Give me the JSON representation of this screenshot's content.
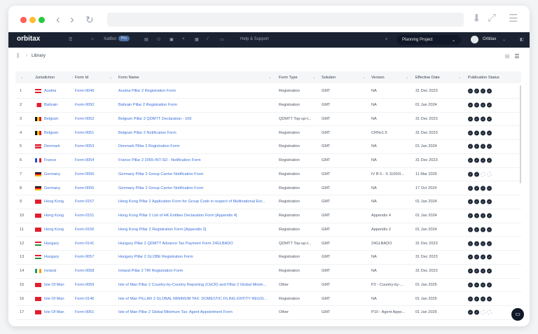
{
  "browser": {
    "back": "‹",
    "forward": "›",
    "reload": "↻",
    "download": "⬇",
    "expand": "⤢",
    "menu": "☰"
  },
  "app": {
    "logo": "orbitax",
    "xatbot": "XatBot",
    "xatbot_badge": "Pro",
    "help": "Help & Support",
    "project": "Planning Project",
    "user": "Orbitax"
  },
  "breadcrumb": {
    "current": "Library"
  },
  "columns": [
    "Jurisdiction",
    "Form Id",
    "Form Name",
    "Form Type",
    "Solution",
    "Version",
    "Effective Date",
    "Publication Status"
  ],
  "rows": [
    {
      "n": "1",
      "j": "Austria",
      "flag": "austria",
      "id": "Form-0049",
      "name": "Austria Pillar 2 Registration Form",
      "type": "Registration",
      "sol": "GMT",
      "ver": "NA",
      "date": "31 Dec 2023",
      "pub": 4
    },
    {
      "n": "2",
      "j": "Bahrain",
      "flag": "bahrain",
      "id": "Form-0050",
      "name": "Bahrain Pillar 2 Registration Form",
      "type": "Registration",
      "sol": "GMT",
      "ver": "NA",
      "date": "01 Jan 2024",
      "pub": 4
    },
    {
      "n": "3",
      "j": "Belgium",
      "flag": "belgium",
      "id": "Form-0052",
      "name": "Belgium Pillar 2 QDMTT Declaration - 169",
      "type": "QDMTT Top-up-t...",
      "sol": "GMT",
      "ver": "NA",
      "date": "31 Dec 2023",
      "pub": 4
    },
    {
      "n": "4",
      "j": "Belgium",
      "flag": "belgium",
      "id": "Form-0051",
      "name": "Belgium Pillar 2 Notification Form",
      "type": "Registration",
      "sol": "GMT",
      "ver": "CRNv1.5",
      "date": "31 Dec 2023",
      "pub": 4
    },
    {
      "n": "5",
      "j": "Denmark",
      "flag": "denmark",
      "id": "Form-0053",
      "name": "Denmark Pillar 2 Registration Form",
      "type": "Registration",
      "sol": "GMT",
      "ver": "NA",
      "date": "01 Jan 2024",
      "pub": 4
    },
    {
      "n": "6",
      "j": "France",
      "flag": "france",
      "id": "Form-0054",
      "name": "France Pillar 2 2065-INT-SD - Notification Form",
      "type": "Registration",
      "sol": "GMT",
      "ver": "NA",
      "date": "31 Dec 2023",
      "pub": 4
    },
    {
      "n": "7",
      "j": "Germany",
      "flag": "germany",
      "id": "Form-0056",
      "name": "Germany Pillar 2 Group Carrier Notification Form",
      "type": "Registration",
      "sol": "GMT",
      "ver": "IV B 5 - S 1100/0...",
      "date": "11 Mar 2025",
      "pub": 2
    },
    {
      "n": "8",
      "j": "Germany",
      "flag": "germany",
      "id": "Form-0055",
      "name": "Germany Pillar 2 Group Carrier Notification Form",
      "type": "Registration",
      "sol": "GMT",
      "ver": "NA",
      "date": "17 Oct 2024",
      "pub": 4
    },
    {
      "n": "9",
      "j": "Hong Kong",
      "flag": "hongkong",
      "id": "Form-0157",
      "name": "Hong Kong Pillar 2 Application Form for Group Code in respect of Multinational Ent...",
      "type": "Registration",
      "sol": "GMT",
      "ver": "NA",
      "date": "01 Jan 2024",
      "pub": 4
    },
    {
      "n": "10",
      "j": "Hong Kong",
      "flag": "hongkong",
      "id": "Form-0151",
      "name": "Hong Kong Pillar 2 List of HK Entities Declaration Form [Appendix 4]",
      "type": "Registration",
      "sol": "GMT",
      "ver": "Appendix 4",
      "date": "01 Jan 2024",
      "pub": 4
    },
    {
      "n": "11",
      "j": "Hong Kong",
      "flag": "hongkong",
      "id": "Form-0156",
      "name": "Hong Kong Pillar 2 Registration Form [Appendix 2]",
      "type": "Registration",
      "sol": "GMT",
      "ver": "Appendix 2",
      "date": "01 Jan 2024",
      "pub": 4
    },
    {
      "n": "12",
      "j": "Hungary",
      "flag": "hungary",
      "id": "Form-0141",
      "name": "Hungary Pillar 2 QDMTT Advance Tax Payment Form 24GLBADO",
      "type": "QDMTT Top-up-t...",
      "sol": "GMT",
      "ver": "24GLBADO",
      "date": "31 Dec 2023",
      "pub": 4
    },
    {
      "n": "13",
      "j": "Hungary",
      "flag": "hungary",
      "id": "Form-0057",
      "name": "Hungary Pillar 2 GLOBE Registration Form",
      "type": "Registration",
      "sol": "GMT",
      "ver": "NA",
      "date": "31 Dec 2023",
      "pub": 4
    },
    {
      "n": "14",
      "j": "Ireland",
      "flag": "ireland",
      "id": "Form-0058",
      "name": "Ireland Pillar 2 TIR Registration Form",
      "type": "Registration",
      "sol": "GMT",
      "ver": "NA",
      "date": "31 Dec 2023",
      "pub": 4
    },
    {
      "n": "15",
      "j": "Isle Of Man",
      "flag": "isleofman",
      "id": "Form-0059",
      "name": "Isle of Man Pillar 2 Country-by-Country Reporting (CbCR) and Pillar 2 Global Minim...",
      "type": "Other",
      "sol": "GMT",
      "ver": "P2 - Country-by-...",
      "date": "01 Jan 2025",
      "pub": 4
    },
    {
      "n": "16",
      "j": "Isle Of Man",
      "flag": "isleofman",
      "id": "Form-0146",
      "name": "Isle of Man PILLAR 2 GLOBAL MINIMUM TAX: DOMESTIC FILING ENTITY REGISTR...",
      "type": "Registration",
      "sol": "GMT",
      "ver": "NA",
      "date": "01 Jan 2025",
      "pub": 4
    },
    {
      "n": "17",
      "j": "Isle Of Man",
      "flag": "isleofman",
      "id": "Form-0061",
      "name": "Isle of Man Pillar 2 Global Minimum Tax: Agent Appointment Form",
      "type": "Other",
      "sol": "GMT",
      "ver": "P10 - Agent Appo...",
      "date": "01 Jan 2025",
      "pub": 2
    }
  ],
  "status_total": 4,
  "flags": {
    "austria": "linear-gradient(#e11d2e 33%,#fff 33% 66%,#e11d2e 66%)",
    "bahrain": "linear-gradient(90deg,#fff 25%,#e11d2e 25%)",
    "belgium": "linear-gradient(90deg,#111 33%,#f5d000 33% 66%,#e11d2e 66%)",
    "denmark": "linear-gradient(#e11d2e 40%,#fff 40% 60%,#e11d2e 60%)",
    "france": "linear-gradient(90deg,#1d4ed8 33%,#fff 33% 66%,#e11d2e 66%)",
    "germany": "linear-gradient(#111 33%,#e11d2e 33% 66%,#f5c000 66%)",
    "hongkong": "#e11d2e",
    "hungary": "linear-gradient(#e11d2e 33%,#fff 33% 66%,#2f8a3a 66%)",
    "ireland": "linear-gradient(90deg,#169b62 33%,#fff 33% 66%,#f59e0b 66%)",
    "isleofman": "#e11d2e"
  }
}
